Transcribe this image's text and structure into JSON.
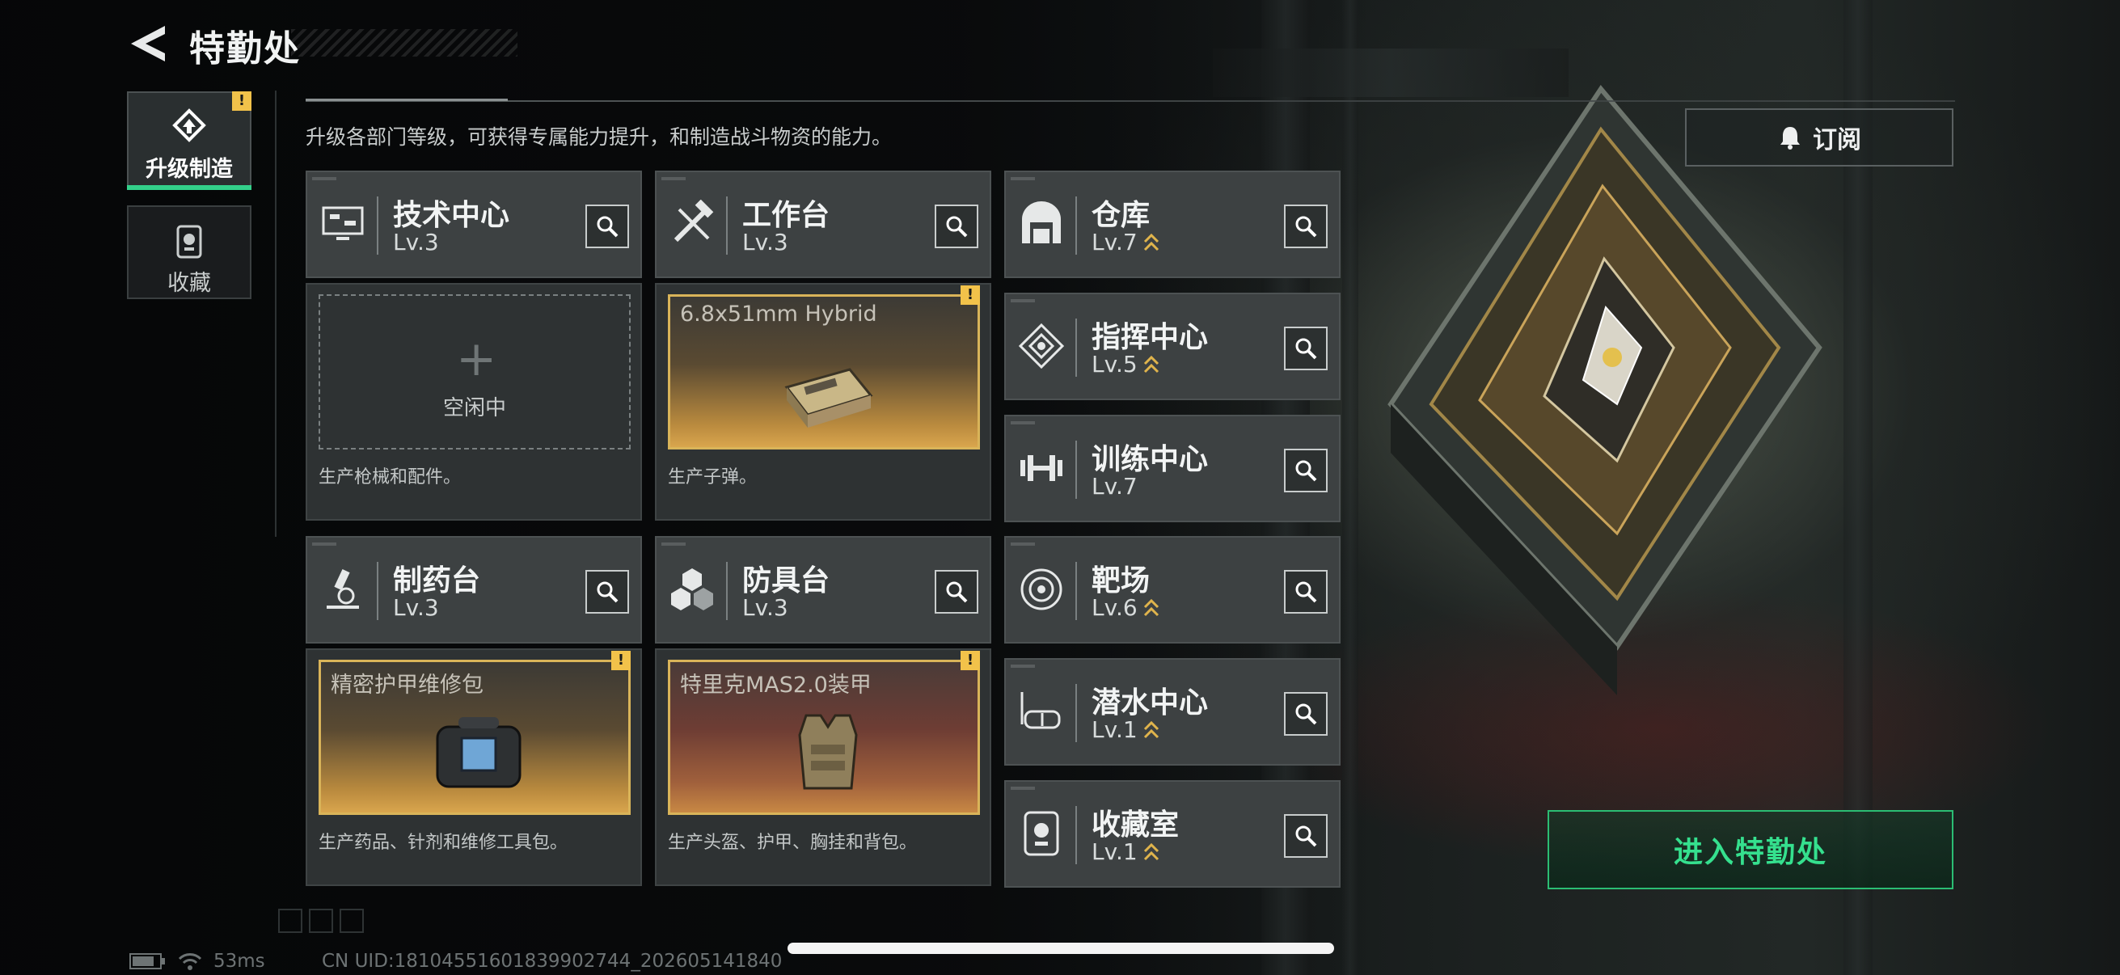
{
  "header": {
    "title": "特勤处"
  },
  "tabs": [
    {
      "label": "升级制造",
      "active": true,
      "badge": "!"
    },
    {
      "label": "收藏",
      "active": false
    }
  ],
  "description": "升级各部门等级，可获得专属能力提升，和制造战斗物资的能力。",
  "subscribe": {
    "label": "订阅",
    "icon": "bell-icon"
  },
  "buildings": {
    "tech": {
      "name": "技术中心",
      "level": "Lv.3",
      "icon": "monitor-icon"
    },
    "workbench": {
      "name": "工作台",
      "level": "Lv.3",
      "icon": "tools-icon"
    },
    "pharma": {
      "name": "制药台",
      "level": "Lv.3",
      "icon": "microscope-icon"
    },
    "armor": {
      "name": "防具台",
      "level": "Lv.3",
      "icon": "cubes-icon"
    },
    "warehouse": {
      "name": "仓库",
      "level": "Lv.7",
      "icon": "garage-icon",
      "upgradeable": true
    },
    "command": {
      "name": "指挥中心",
      "level": "Lv.5",
      "icon": "command-icon",
      "upgradeable": true
    },
    "training": {
      "name": "训练中心",
      "level": "Lv.7",
      "icon": "dumbbell-icon"
    },
    "range": {
      "name": "靶场",
      "level": "Lv.6",
      "icon": "target-icon",
      "upgradeable": true
    },
    "diving": {
      "name": "潜水中心",
      "level": "Lv.1",
      "icon": "diving-mask-icon",
      "upgradeable": true
    },
    "collection": {
      "name": "收藏室",
      "level": "Lv.1",
      "icon": "trophy-icon",
      "upgradeable": true
    }
  },
  "production": {
    "tech": {
      "status": "空闲中",
      "plus": "+",
      "desc": "生产枪械和配件。"
    },
    "workbench": {
      "item": "6.8x51mm Hybrid",
      "desc": "生产子弹。",
      "badge": "!"
    },
    "pharma": {
      "item": "精密护甲维修包",
      "desc": "生产药品、针剂和维修工具包。",
      "badge": "!"
    },
    "armor": {
      "item": "特里克MAS2.0装甲",
      "desc": "生产头盔、护甲、胸挂和背包。",
      "badge": "!"
    }
  },
  "enter_button": {
    "label": "进入特勤处"
  },
  "status_bar": {
    "ping": "53ms",
    "uid": "CN UID:1810455160183990274­4_202605141840"
  },
  "colors": {
    "accent_green": "#33d08a",
    "gold": "#d9b459",
    "warning": "#f2c24a"
  }
}
